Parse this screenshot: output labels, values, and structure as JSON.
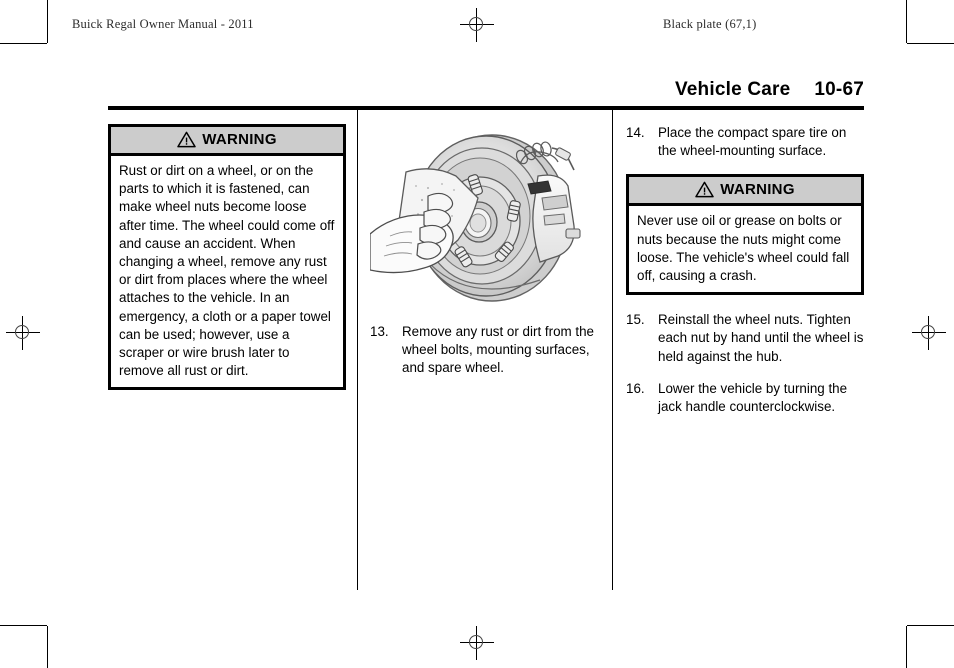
{
  "running_head": {
    "left": "Buick Regal Owner Manual - 2011",
    "right": "Black plate (67,1)"
  },
  "page_title": {
    "section": "Vehicle Care",
    "page_number": "10-67"
  },
  "columns": {
    "left": {
      "warning": {
        "icon": "warning-triangle-icon",
        "label": "WARNING",
        "body": "Rust or dirt on a wheel, or on the parts to which it is fastened, can make wheel nuts become loose after time. The wheel could come off and cause an accident. When changing a wheel, remove any rust or dirt from places where the wheel attaches to the vehicle. In an emergency, a cloth or a paper towel can be used; however, use a scraper or wire brush later to remove all rust or dirt."
      }
    },
    "middle": {
      "figure": {
        "name": "wheel-hub-cleaning-illustration",
        "description": "Hand with a cloth wiping rust and dirt from the wheel bolts and mounting surface of a brake rotor and hub assembly"
      },
      "step": {
        "number": "13.",
        "text": "Remove any rust or dirt from the wheel bolts, mounting surfaces, and spare wheel."
      }
    },
    "right": {
      "step_14": {
        "number": "14.",
        "text": "Place the compact spare tire on the wheel-mounting surface."
      },
      "warning": {
        "icon": "warning-triangle-icon",
        "label": "WARNING",
        "body": "Never use oil or grease on bolts or nuts because the nuts might come loose. The vehicle's wheel could fall off, causing a crash."
      },
      "step_15": {
        "number": "15.",
        "text": "Reinstall the wheel nuts. Tighten each nut by hand until the wheel is held against the hub."
      },
      "step_16": {
        "number": "16.",
        "text": "Lower the vehicle by turning the jack handle counterclockwise."
      }
    }
  },
  "colors": {
    "warning_header_gray": "#cccccc",
    "rule_black": "#000000",
    "illustration_gray": "#d8d8d8"
  }
}
